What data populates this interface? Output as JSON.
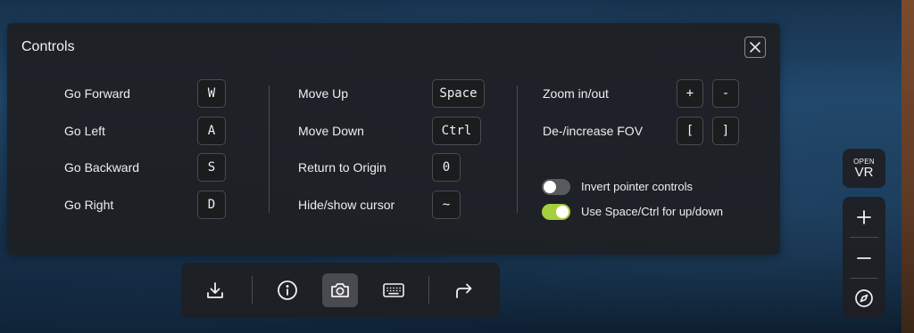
{
  "panel": {
    "title": "Controls",
    "close_icon": "close-icon",
    "columns": [
      {
        "rows": [
          {
            "label": "Go Forward",
            "keys": [
              "W"
            ]
          },
          {
            "label": "Go Left",
            "keys": [
              "A"
            ]
          },
          {
            "label": "Go Backward",
            "keys": [
              "S"
            ]
          },
          {
            "label": "Go Right",
            "keys": [
              "D"
            ]
          }
        ]
      },
      {
        "rows": [
          {
            "label": "Move Up",
            "keys": [
              "Space"
            ]
          },
          {
            "label": "Move Down",
            "keys": [
              "Ctrl"
            ]
          },
          {
            "label": "Return to Origin",
            "keys": [
              "0"
            ]
          },
          {
            "label": "Hide/show cursor",
            "keys": [
              "~"
            ]
          }
        ]
      },
      {
        "rows": [
          {
            "label": "Zoom in/out",
            "keys": [
              "+",
              "-"
            ]
          },
          {
            "label": "De-/increase FOV",
            "keys": [
              "[",
              "]"
            ]
          }
        ],
        "toggles": [
          {
            "label": "Invert pointer controls",
            "on": false
          },
          {
            "label": "Use Space/Ctrl for up/down",
            "on": true
          }
        ]
      }
    ]
  },
  "toolbar": {
    "buttons": [
      {
        "icon": "download-icon",
        "active": false
      },
      {
        "icon": "info-icon",
        "active": false
      },
      {
        "icon": "camera-icon",
        "active": true
      },
      {
        "icon": "keyboard-icon",
        "active": false
      },
      {
        "icon": "share-icon",
        "active": false
      }
    ]
  },
  "right_controls": {
    "vr": {
      "top": "OPEN",
      "bottom": "VR"
    },
    "zoom_in_icon": "plus-icon",
    "zoom_out_icon": "minus-icon",
    "compass_icon": "compass-icon"
  },
  "colors": {
    "panel_bg": "#1e1f22",
    "toggle_on": "#a6cf3f",
    "toggle_off": "#595a5e",
    "text": "#eeeeee"
  }
}
